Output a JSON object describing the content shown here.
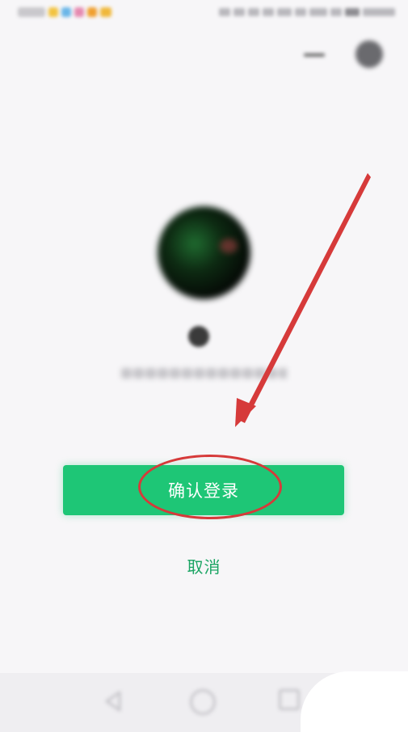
{
  "status_bar": {
    "time": ""
  },
  "header": {
    "title": "",
    "back_icon": "back-arrow-icon",
    "more_icon": "more-icon"
  },
  "profile": {
    "nickname": "",
    "login_hint": ""
  },
  "actions": {
    "confirm_label": "确认登录",
    "cancel_label": "取消"
  },
  "nav_bar": {
    "back_icon": "nav-back-icon",
    "home_icon": "nav-home-icon",
    "recent_icon": "nav-recent-icon"
  },
  "colors": {
    "accent": "#1ec676",
    "cancel_text": "#1aa463",
    "annotation": "#d63a3a"
  }
}
